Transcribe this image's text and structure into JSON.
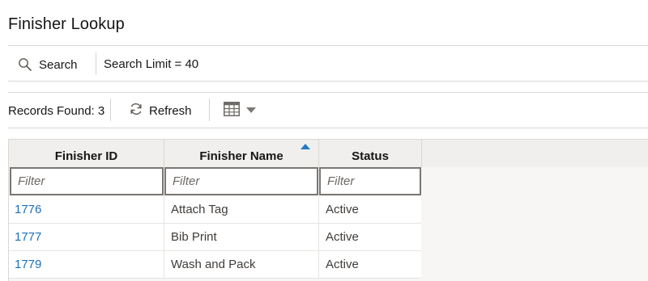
{
  "page": {
    "title": "Finisher Lookup"
  },
  "search": {
    "label": "Search",
    "limit_text": "Search Limit = 40"
  },
  "toolbar": {
    "records_found": "Records Found: 3",
    "refresh_label": "Refresh"
  },
  "table": {
    "columns": [
      {
        "label": "Finisher ID"
      },
      {
        "label": "Finisher Name",
        "sorted": "ascending"
      },
      {
        "label": "Status"
      }
    ],
    "filter_placeholder": "Filter",
    "rows": [
      {
        "id": "1776",
        "name": "Attach Tag",
        "status": "Active"
      },
      {
        "id": "1777",
        "name": "Bib Print",
        "status": "Active"
      },
      {
        "id": "1779",
        "name": "Wash and Pack",
        "status": "Active"
      }
    ]
  },
  "colors": {
    "link": "#1f6fb8",
    "sort_indicator": "#227bc2"
  },
  "icons": {
    "search": "magnifier-icon",
    "refresh": "refresh-icon",
    "columns": "grid-columns-icon",
    "dropdown": "caret-down-icon"
  }
}
